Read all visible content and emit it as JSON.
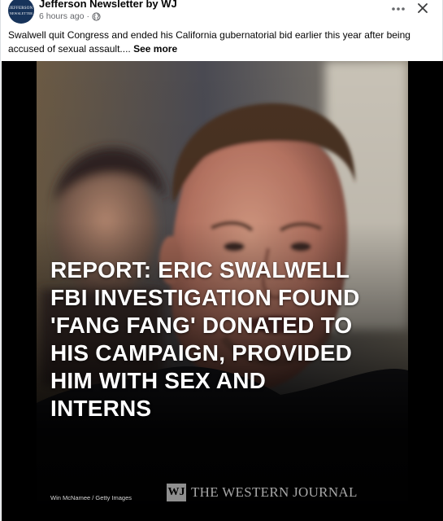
{
  "post": {
    "page_name": "Jefferson Newsletter by WJ",
    "timestamp": "6 hours ago",
    "separator": "·",
    "audience_icon": "globe-icon",
    "caption": "Swalwell quit Congress and ended his California gubernatorial bid earlier this year after being accused of sexual assault....",
    "see_more": "See more",
    "avatar": {
      "line1": "JEFFERSON",
      "line2": "NEWSLETTER"
    },
    "controls": {
      "more_icon": "more-horizontal-icon",
      "close_icon": "close-icon"
    }
  },
  "media": {
    "headline": "REPORT: ERIC SWALWELL FBI INVESTIGATION FOUND 'FANG FANG' DONATED TO HIS CAMPAIGN, PROVIDED HIM WITH SEX AND INTERNS",
    "photo_credit": "Win McNamee / Getty Images",
    "publisher_mark": "WJ",
    "publisher_name": "THE WESTERN JOURNAL"
  },
  "colors": {
    "text_primary": "#050505",
    "text_secondary": "#65676b",
    "media_background": "#000000",
    "headline_text": "#ffffff"
  }
}
